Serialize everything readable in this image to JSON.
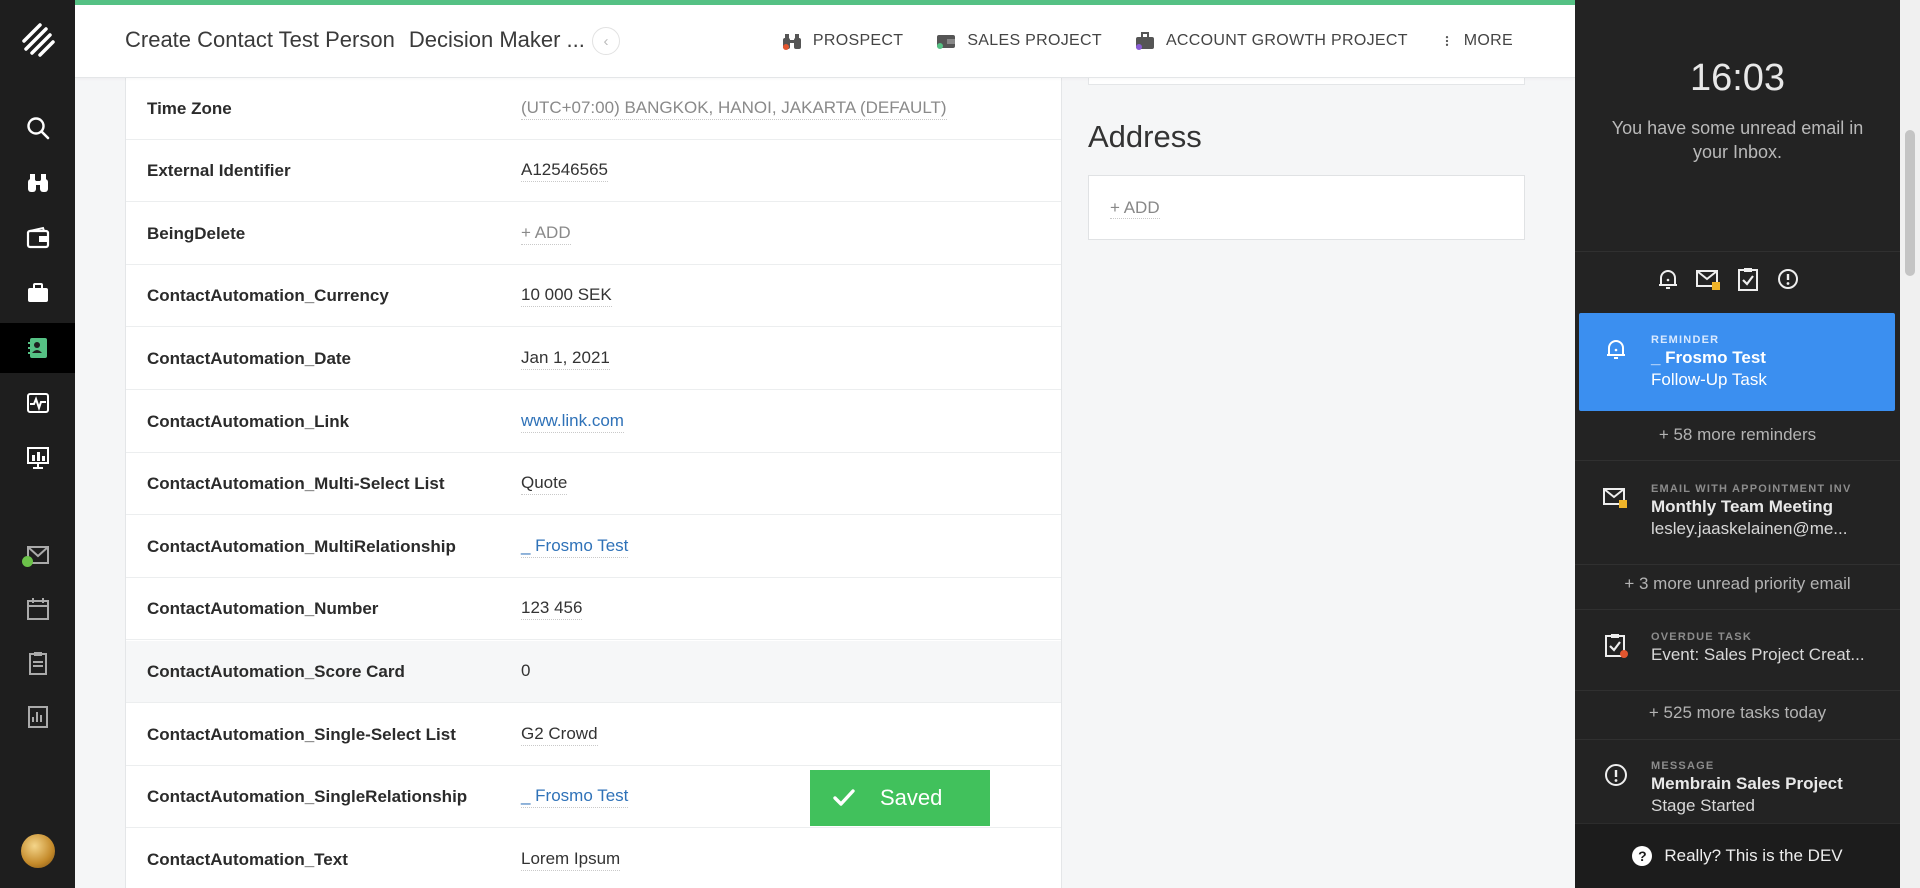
{
  "nav": {
    "items": [
      {
        "icon": "search-icon"
      },
      {
        "icon": "binoculars-icon"
      },
      {
        "icon": "wallet-icon"
      },
      {
        "icon": "briefcase-icon"
      },
      {
        "icon": "contacts-icon"
      },
      {
        "icon": "activity-icon"
      },
      {
        "icon": "presentation-icon"
      },
      {
        "icon": "mail-icon"
      },
      {
        "icon": "calendar-icon"
      },
      {
        "icon": "clipboard-icon"
      },
      {
        "icon": "report-icon"
      }
    ]
  },
  "header": {
    "title": "Create Contact Test Person",
    "subtitle": "Decision Maker ...",
    "back_icon": "chevron-left-icon",
    "actions": [
      {
        "label": "PROSPECT",
        "icon": "binoculars-icon"
      },
      {
        "label": "SALES PROJECT",
        "icon": "wallet-icon"
      },
      {
        "label": "ACCOUNT GROWTH PROJECT",
        "icon": "briefcase-icon"
      },
      {
        "label": "MORE",
        "icon": "more-vertical-icon"
      }
    ]
  },
  "fields": [
    {
      "label": "Time Zone",
      "value": "(UTC+07:00) BANGKOK, HANOI, JAKARTA (DEFAULT)",
      "style": "muted"
    },
    {
      "label": "External Identifier",
      "value": "A12546565",
      "style": ""
    },
    {
      "label": "BeingDelete",
      "value": "+ ADD",
      "style": "muted"
    },
    {
      "label": "ContactAutomation_Currency",
      "value": "10 000 SEK",
      "style": ""
    },
    {
      "label": "ContactAutomation_Date",
      "value": "Jan 1, 2021",
      "style": ""
    },
    {
      "label": "ContactAutomation_Link",
      "value": "www.link.com",
      "style": "link"
    },
    {
      "label": "ContactAutomation_Multi-Select List",
      "value": "Quote",
      "style": ""
    },
    {
      "label": "ContactAutomation_MultiRelationship",
      "value": "_ Frosmo Test",
      "style": "link"
    },
    {
      "label": "ContactAutomation_Number",
      "value": "123 456",
      "style": ""
    },
    {
      "label": "ContactAutomation_Score Card",
      "value": "0",
      "style": "",
      "highlight": true
    },
    {
      "label": "ContactAutomation_Single-Select List",
      "value": "G2 Crowd",
      "style": ""
    },
    {
      "label": "ContactAutomation_SingleRelationship",
      "value": "_ Frosmo Test",
      "style": "link"
    },
    {
      "label": "ContactAutomation_Text",
      "value": "Lorem Ipsum",
      "style": ""
    }
  ],
  "address": {
    "title": "Address",
    "add_label": "+ ADD"
  },
  "toast": {
    "label": "Saved"
  },
  "panel": {
    "time": "16:03",
    "message": "You have some unread email in your Inbox.",
    "filter_icons": [
      "bell-icon",
      "mail-lock-icon",
      "clipboard-check-icon",
      "info-icon"
    ],
    "reminder": {
      "category": "REMINDER",
      "title": "_ Frosmo Test",
      "subtitle": "Follow-Up Task"
    },
    "more_reminders": "+ 58 more reminders",
    "email": {
      "category": "EMAIL WITH APPOINTMENT INV",
      "title": "Monthly Team Meeting",
      "subtitle": "lesley.jaaskelainen@me..."
    },
    "more_email": "+ 3 more unread priority email",
    "task": {
      "category": "OVERDUE TASK",
      "title": "Event: Sales Project Creat..."
    },
    "more_tasks": "+ 525 more tasks today",
    "message_card": {
      "category": "MESSAGE",
      "title": "Membrain Sales Project",
      "subtitle": "Stage Started"
    },
    "help_label": "Really? This is the DEV"
  },
  "colors": {
    "accent_green": "#55c184",
    "toast_green": "#41c15c",
    "reminder_blue": "#3b8ff0",
    "link_blue": "#2f72b8"
  }
}
